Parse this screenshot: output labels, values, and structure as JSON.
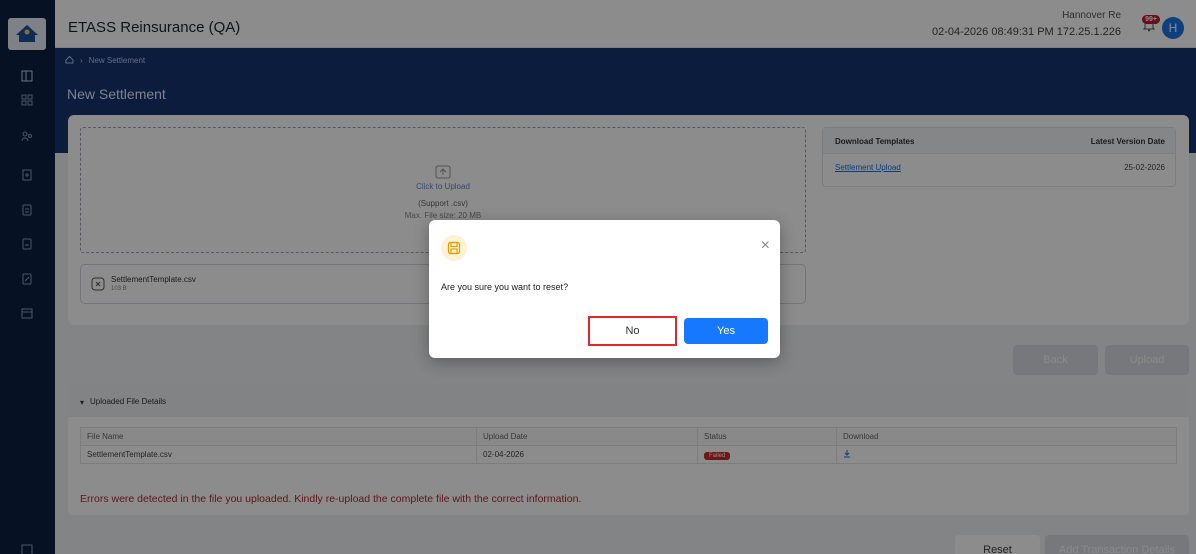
{
  "app": {
    "title": "ETASS Reinsurance (QA)",
    "org": "Hannover Re",
    "datetime": "02-04-2026 08:49:31 PM",
    "ip": "172.25.1.226",
    "notif_count": "99+",
    "avatar_initial": "H"
  },
  "breadcrumb": {
    "current": "New Settlement"
  },
  "page": {
    "title": "New Settlement"
  },
  "upload": {
    "prompt": "Click to Upload",
    "support": "(Support .csv)",
    "max_size": "Max. File size: 20 MB"
  },
  "file": {
    "name": "SettlementTemplate.csv",
    "size": "103 B"
  },
  "templates": {
    "col_download": "Download Templates",
    "col_version": "Latest Version Date",
    "rows": [
      {
        "name": "Settlement Upload",
        "date": "25-02-2026"
      }
    ]
  },
  "buttons": {
    "back": "Back",
    "upload": "Upload",
    "reset": "Reset",
    "add_txn": "Add Transaction Details"
  },
  "uploaded_details": {
    "title": "Uploaded File Details",
    "headers": [
      "File Name",
      "Upload Date",
      "Status",
      "Download"
    ],
    "rows": [
      {
        "file": "SettlementTemplate.csv",
        "date": "02-04-2026",
        "status": "Failed"
      }
    ],
    "error": "Errors were detected in the file you uploaded. Kindly re-upload the complete file with the correct information."
  },
  "modal": {
    "message": "Are you sure you want to reset?",
    "no": "No",
    "yes": "Yes"
  },
  "colors": {
    "sidebar": "#0c2143",
    "header_band": "#16346d",
    "primary": "#1677ff",
    "error": "#b02a2a",
    "highlight": "#e0272a"
  }
}
